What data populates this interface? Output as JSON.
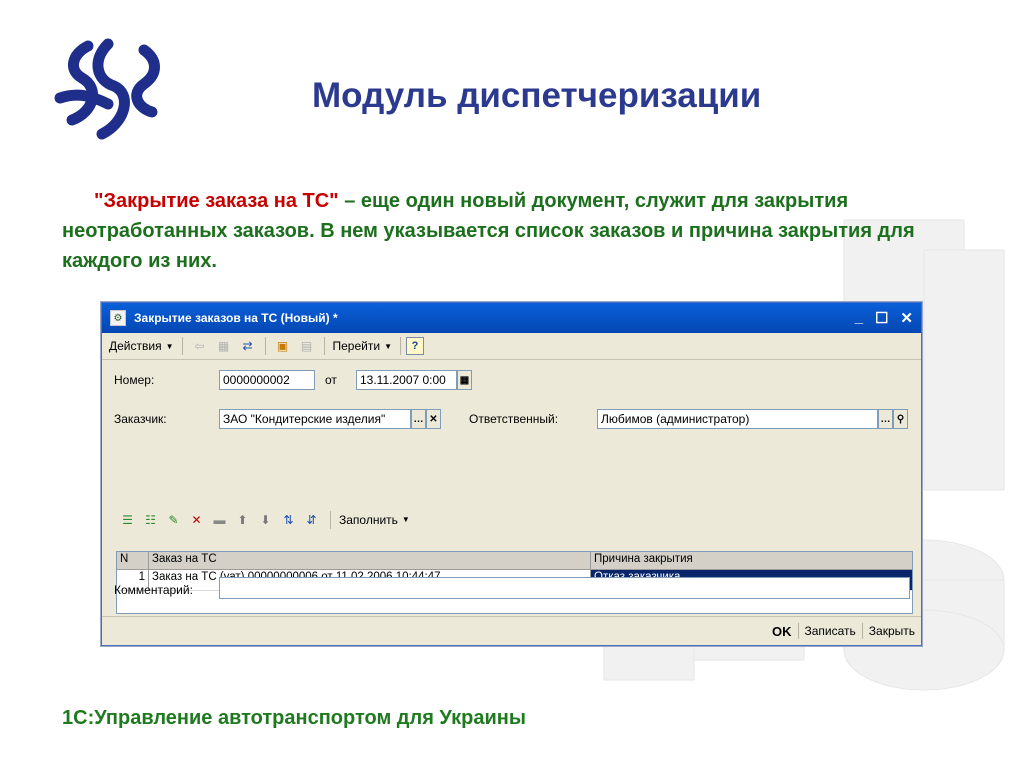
{
  "slide": {
    "title": "Модуль диспетчеризации",
    "desc_highlight": "\"Закрытие заказа на ТС\"",
    "desc_rest": " – еще один новый документ, служит для закрытия неотработанных заказов. В нем указывается список заказов и причина закрытия для каждого из них.",
    "footer": "1С:Управление автотранспортом для Украины"
  },
  "window": {
    "title": "Закрытие заказов на ТС (Новый) *",
    "controls": {
      "minimize": "_",
      "maximize": "☐",
      "close": "✕"
    },
    "toolbar": {
      "actions_label": "Действия",
      "goto_label": "Перейти",
      "help_label": "?"
    },
    "form": {
      "number_label": "Номер:",
      "number_value": "0000000002",
      "date_sep": "от",
      "date_value": "13.11.2007  0:00",
      "customer_label": "Заказчик:",
      "customer_value": "ЗАО \"Кондитерские изделия\"",
      "responsible_label": "Ответственный:",
      "responsible_value": "Любимов (администратор)",
      "fill_label": "Заполнить",
      "comment_label": "Комментарий:",
      "comment_value": ""
    },
    "table": {
      "headers": [
        "N",
        "Заказ на ТС",
        "Причина закрытия"
      ],
      "rows": [
        {
          "n": "1",
          "order": "Заказ на ТС (уат) 00000000006 от 11.02.2006 10:44:47",
          "reason": "Отказ заказчика"
        }
      ]
    },
    "buttons": {
      "ok": "OK",
      "save": "Записать",
      "close": "Закрыть"
    }
  },
  "colors": {
    "title": "#2b3a8f",
    "desc_text": "#1c6f1c",
    "highlight": "#c80000",
    "titlebar": "#0a5fd8",
    "selection": "#0a246a"
  }
}
